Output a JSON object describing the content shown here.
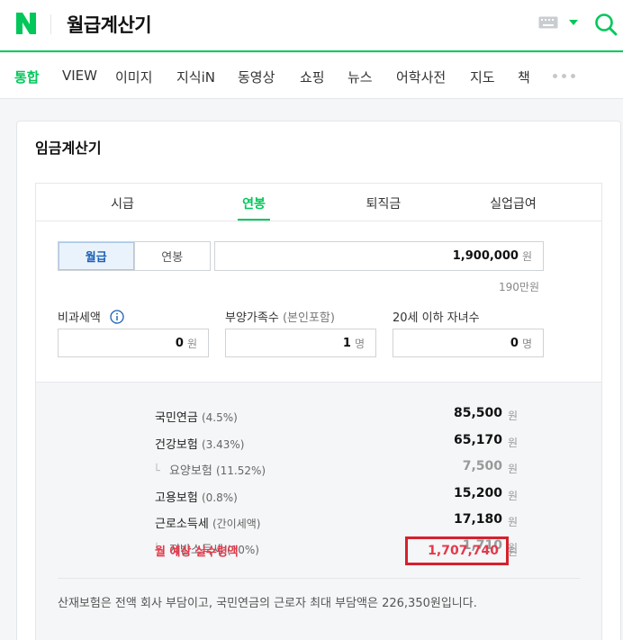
{
  "header": {
    "query": "월급계산기",
    "logo_letter": "N",
    "brand_color": "#03c75a",
    "icons": [
      "keyboard-icon",
      "chevron-down-icon",
      "search-icon"
    ]
  },
  "nav_tabs": [
    {
      "label": "통합",
      "active": true
    },
    {
      "label": "VIEW"
    },
    {
      "label": "이미지"
    },
    {
      "label": "지식iN"
    },
    {
      "label": "동영상"
    },
    {
      "label": "쇼핑"
    },
    {
      "label": "뉴스"
    },
    {
      "label": "어학사전"
    },
    {
      "label": "지도"
    },
    {
      "label": "책"
    }
  ],
  "card": {
    "title": "임금계산기",
    "calc_tabs": [
      {
        "label": "시급"
      },
      {
        "label": "연봉",
        "active": true
      },
      {
        "label": "퇴직금"
      },
      {
        "label": "실업급여"
      }
    ],
    "pay_type": {
      "options": [
        "월급",
        "연봉"
      ],
      "selected": "월급"
    },
    "amount": {
      "value": "1,900,000",
      "unit": "원",
      "hint": "190만원"
    },
    "fields": [
      {
        "label": "비과세액",
        "sub": "",
        "value": "0",
        "unit": "원"
      },
      {
        "label": "부양가족수",
        "sub": "(본인포함)",
        "value": "1",
        "unit": "명"
      },
      {
        "label": "20세 이하 자녀수",
        "sub": "",
        "value": "0",
        "unit": "명"
      }
    ],
    "deductions": [
      {
        "label": "국민연금",
        "pct": "(4.5%)",
        "value": "85,500",
        "unit": "원"
      },
      {
        "label": "건강보험",
        "pct": "(3.43%)",
        "value": "65,170",
        "unit": "원"
      },
      {
        "label": "요양보험",
        "pct": "(11.52%)",
        "value": "7,500",
        "unit": "원",
        "sub": true
      },
      {
        "label": "고용보험",
        "pct": "(0.8%)",
        "value": "15,200",
        "unit": "원"
      },
      {
        "label": "근로소득세",
        "pct": "(간이세액)",
        "value": "17,180",
        "unit": "원"
      },
      {
        "label": "지방소득세",
        "pct": "(10%)",
        "value": "1,710",
        "unit": "원",
        "sub": true
      }
    ],
    "net_pay": {
      "label": "월 예상 실수령액",
      "value": "1,707,740",
      "unit": "원"
    },
    "footnote": "산재보험은 전액 회사 부담이고, 국민연금의 근로자 최대 부담액은 226,350원입니다."
  }
}
